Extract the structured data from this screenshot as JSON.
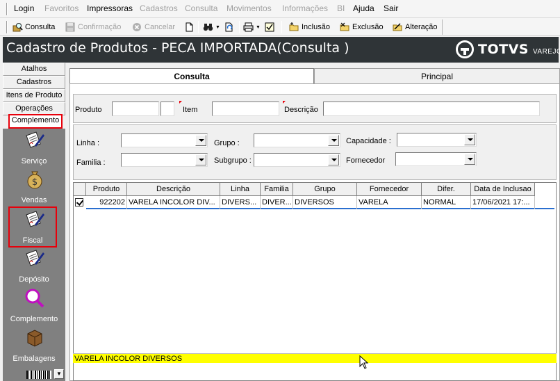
{
  "menu": {
    "items": [
      {
        "label": "Login",
        "ul": "L",
        "rest": "ogin",
        "enabled": true
      },
      {
        "label": "Favoritos",
        "enabled": false
      },
      {
        "label": "Impressoras",
        "ul": "I",
        "rest": "mpressoras",
        "enabled": true
      },
      {
        "label": "Cadastros",
        "enabled": false
      },
      {
        "label": "Consulta",
        "enabled": false
      },
      {
        "label": "Movimentos",
        "enabled": false
      },
      {
        "label": "Informações",
        "enabled": false
      },
      {
        "label": "BI",
        "enabled": false
      },
      {
        "label": "Ajuda",
        "ul": "A",
        "rest": "juda",
        "enabled": true
      },
      {
        "label": "Sair",
        "ul": "S",
        "rest": "air",
        "enabled": true
      }
    ]
  },
  "toolbar": {
    "consulta": "Consulta",
    "confirmacao": "Confirmação",
    "cancelar": "Cancelar",
    "inclusao": "Inclusão",
    "exclusao": "Exclusão",
    "alteracao": "Alteração"
  },
  "title": {
    "text": "Cadastro de Produtos  - PECA IMPORTADA(Consulta )",
    "brand": "TOTVS",
    "brand_sub": "VAREJO"
  },
  "sidebar": {
    "buttons": [
      "Atalhos",
      "Cadastros",
      "Itens de Produto",
      "Operações",
      "Complemento"
    ],
    "items": [
      "Serviço",
      "Vendas",
      "Fiscal",
      "Depósito",
      "Complemento",
      "Embalagens"
    ]
  },
  "tabs": {
    "consulta": "Consulta",
    "principal": "Principal"
  },
  "filters": {
    "produto": "Produto",
    "item": "Item",
    "descricao": "Descrição",
    "linha": "Linha :",
    "grupo": "Grupo :",
    "capacidade": "Capacidade :",
    "familia": "Familia :",
    "subgrupo": "Subgrupo :",
    "fornecedor": "Fornecedor"
  },
  "table": {
    "columns": [
      "Produto",
      "Descrição",
      "Linha",
      "Familia",
      "Grupo",
      "Fornecedor",
      "Difer.",
      "Data de Inclusao"
    ],
    "rows": [
      [
        "922202",
        "VARELA INCOLOR DIV...",
        "DIVERS...",
        "DIVER...",
        "DIVERSOS",
        "VARELA",
        "NORMAL",
        "17/06/2021 17:..."
      ]
    ]
  },
  "status_line": "VARELA INCOLOR DIVERSOS",
  "colors": {
    "title_bg": "#2f3437",
    "highlight": "#e8000b",
    "status_bg": "#ffff00",
    "sidebar_bg": "#808080"
  }
}
